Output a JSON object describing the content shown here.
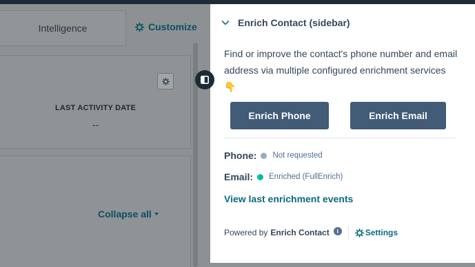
{
  "background": {
    "tab_intelligence": "Intelligence",
    "customize_label": "Customize",
    "last_activity_label": "LAST ACTIVITY DATE",
    "last_activity_value": "--",
    "collapse_all_label": "Collapse all"
  },
  "sidebar": {
    "title": "Enrich Contact (sidebar)",
    "description": "Find or improve the contact's phone number and email address via multiple configured enrichment services 👇",
    "buttons": {
      "enrich_phone": "Enrich Phone",
      "enrich_email": "Enrich Email"
    },
    "phone": {
      "label": "Phone:",
      "status": "Not requested",
      "status_color": "#99acc2"
    },
    "email": {
      "label": "Email:",
      "status": "Enriched (FullEnrich)",
      "status_color": "#00bda5"
    },
    "view_events_link": "View last enrichment events",
    "footer": {
      "powered_by": "Powered by",
      "brand": "Enrich Contact",
      "settings_label": "Settings"
    }
  },
  "colors": {
    "primary_button": "#425b76",
    "link": "#0b6a80",
    "text": "#33475b",
    "overlay_dim": "#8f9294"
  },
  "icons": [
    "gear-icon",
    "chevron-down-icon",
    "panel-toggle-icon",
    "info-icon",
    "caret-down-icon"
  ]
}
